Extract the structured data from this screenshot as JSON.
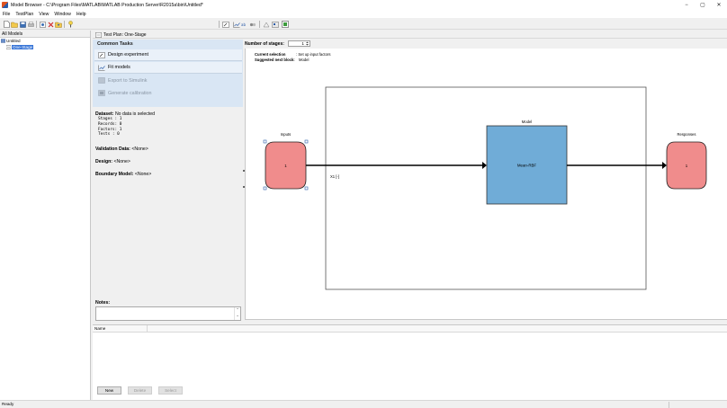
{
  "window": {
    "title": "Model Browser - C:\\Program Files\\MATLAB\\MATLAB Production Server\\R2015a\\bin\\Untitled*",
    "minimize_glyph": "−",
    "maximize_glyph": "▢",
    "close_glyph": "✕"
  },
  "menu": [
    "File",
    "TestPlan",
    "View",
    "Window",
    "Help"
  ],
  "tree": {
    "header": "All Models",
    "root": "Untitled",
    "child": "One-Stage"
  },
  "test_plan": {
    "header": "Test Plan: One-Stage"
  },
  "tasks": {
    "title": "Common Tasks",
    "items": [
      {
        "label": "Design experiment",
        "enabled": true,
        "icon": "design-experiment-icon"
      },
      {
        "label": "Fit models",
        "enabled": true,
        "icon": "fit-models-icon"
      },
      {
        "label": "Export to Simulink",
        "enabled": false,
        "icon": "simulink-icon"
      },
      {
        "label": "Generate calibration",
        "enabled": false,
        "icon": "calibration-icon"
      }
    ]
  },
  "dataset": {
    "label": "Dataset:",
    "value": "No data is selected",
    "rows": [
      "Stages :     1",
      "Records:     0",
      "Factors:     1",
      "Tests  :     0"
    ]
  },
  "validation": {
    "label": "Validation Data:",
    "value": "<None>"
  },
  "design": {
    "label": "Design:",
    "value": "<None>"
  },
  "boundary": {
    "label": "Boundary Model:",
    "value": "<None>"
  },
  "notes": {
    "label": "Notes:",
    "scroll_up": "⌃",
    "scroll_down": "⌄"
  },
  "stages": {
    "label": "Number of stages:",
    "value": "1"
  },
  "diagram": {
    "current_selection_label": "Current selection",
    "current_selection_value": ": Set up input factors",
    "next_block_label": "Suggested next block:",
    "next_block_value": "Model",
    "inputs_label": "Inputs",
    "input_value": "1",
    "model_label": "Model",
    "model_text": "Mean-RBF",
    "responses_label": "Responses",
    "response_value": "1",
    "factor_label": "X1 [-]",
    "colors": {
      "input_fill": "#f08c8c",
      "model_fill": "#70acd7"
    }
  },
  "list": {
    "column_name": "Name",
    "buttons": [
      {
        "label": "New",
        "enabled": true
      },
      {
        "label": "Delete",
        "enabled": false
      },
      {
        "label": "Select",
        "enabled": false
      }
    ]
  },
  "status": {
    "text": "Ready"
  }
}
